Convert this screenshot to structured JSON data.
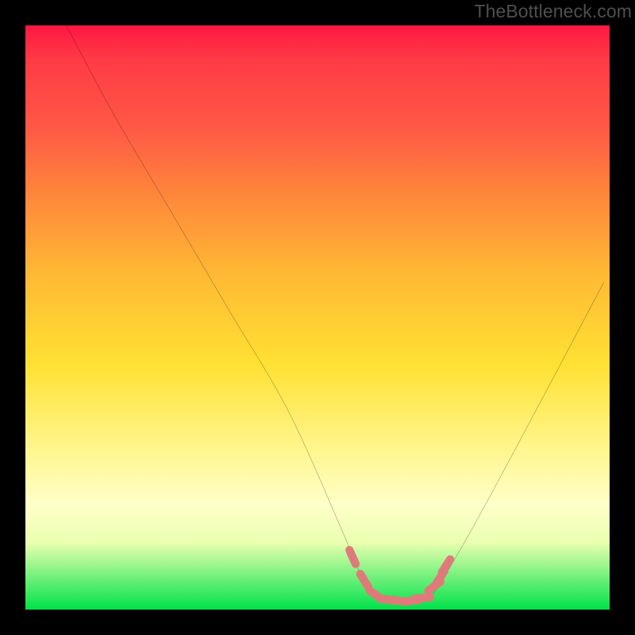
{
  "watermark": "TheBottleneck.com",
  "colors": {
    "curve": "#000000",
    "marker": "#e07a7a",
    "gradient_top": "#ff1744",
    "gradient_bottom": "#00e24a"
  },
  "chart_data": {
    "type": "line",
    "title": "",
    "xlabel": "",
    "ylabel": "",
    "xlim": [
      0,
      100
    ],
    "ylim": [
      0,
      100
    ],
    "grid": false,
    "series": [
      {
        "name": "bottleneck-curve",
        "x": [
          7,
          15,
          25,
          35,
          45,
          54,
          56,
          58,
          60,
          63,
          67,
          69,
          71,
          76,
          82,
          90,
          99
        ],
        "y": [
          100,
          85,
          68,
          51,
          34,
          14,
          9,
          5,
          2.5,
          1.5,
          1.5,
          2,
          4.5,
          13,
          24,
          39,
          56
        ]
      }
    ],
    "markers": {
      "color": "#e07a7a",
      "points": [
        {
          "x": 56,
          "y": 9
        },
        {
          "x": 58,
          "y": 5
        },
        {
          "x": 60,
          "y": 2.5
        },
        {
          "x": 62,
          "y": 1.7
        },
        {
          "x": 64,
          "y": 1.5
        },
        {
          "x": 66,
          "y": 1.5
        },
        {
          "x": 68,
          "y": 2
        },
        {
          "x": 70,
          "y": 4
        },
        {
          "x": 71,
          "y": 5.5
        },
        {
          "x": 72,
          "y": 7.5
        }
      ]
    }
  }
}
